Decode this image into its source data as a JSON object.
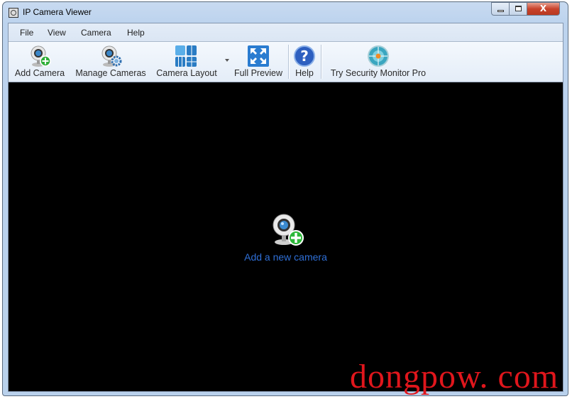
{
  "window": {
    "title": "IP Camera Viewer",
    "controls": {
      "minimize": "minimize",
      "maximize": "maximize",
      "close": "X"
    }
  },
  "menubar": {
    "items": [
      {
        "label": "File"
      },
      {
        "label": "View"
      },
      {
        "label": "Camera"
      },
      {
        "label": "Help"
      }
    ]
  },
  "toolbar": {
    "buttons": [
      {
        "label": "Add Camera",
        "icon": "webcam-add-icon"
      },
      {
        "label": "Manage Cameras",
        "icon": "webcam-gear-icon"
      },
      {
        "label": "Camera Layout",
        "icon": "grid-layout-icon",
        "has_dropdown": true
      },
      {
        "label": "Full Preview",
        "icon": "fullscreen-arrows-icon"
      },
      {
        "label": "Help",
        "icon": "question-icon"
      },
      {
        "label": "Try Security Monitor Pro",
        "icon": "target-icon"
      }
    ]
  },
  "main": {
    "add_camera_link": "Add a new camera",
    "add_camera_icon": "webcam-add-icon"
  },
  "watermark": "dongpow. com",
  "colors": {
    "link": "#2f6fd6",
    "watermark": "#e0161c",
    "content_bg": "#000000"
  }
}
